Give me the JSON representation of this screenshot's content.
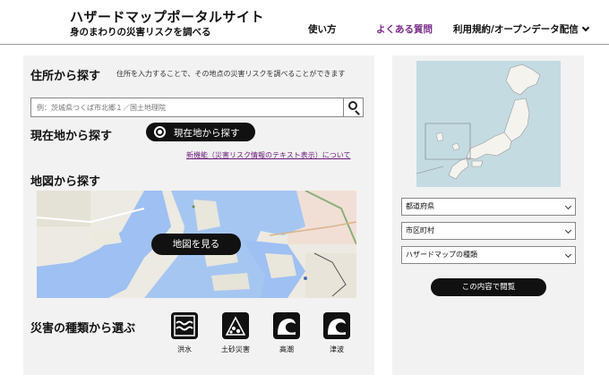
{
  "header": {
    "title": "ハザードマップポータルサイト",
    "subtitle": "身のまわりの災害リスクを調べる",
    "nav": {
      "howto": "使い方",
      "faq": "よくある質問",
      "terms": "利用規約/オープンデータ配信"
    }
  },
  "address_search": {
    "title": "住所から探す",
    "description": "住所を入力することで、その地点の災害リスクを調べることができます",
    "placeholder": "例：茨城県つくば市北郷１／国土地理院"
  },
  "current_location": {
    "title": "現在地から探す",
    "button_label": "現在地から探す"
  },
  "new_feature_link": "新機能（災害リスク情報のテキスト表示）について",
  "map_search": {
    "title": "地図から探す",
    "button_label": "地図を見る"
  },
  "hazard_types": {
    "title": "災害の種類から選ぶ",
    "items": [
      {
        "label": "洪水",
        "icon": "flood-icon"
      },
      {
        "label": "土砂災害",
        "icon": "landslide-icon"
      },
      {
        "label": "高潮",
        "icon": "storm-surge-icon"
      },
      {
        "label": "津波",
        "icon": "tsunami-icon"
      }
    ]
  },
  "region_select": {
    "prefecture": "都道府県",
    "city": "市区町村",
    "map_type": "ハザードマップの種類",
    "view_button": "この内容で閲覧"
  },
  "colors": {
    "panel_bg": "#f2f2f2",
    "button_bg": "#111111",
    "link": "#6a1a7a",
    "faq_nav": "#7a2a8a",
    "japan_sea": "#c4dbe2",
    "land": "#f4f3ee"
  }
}
